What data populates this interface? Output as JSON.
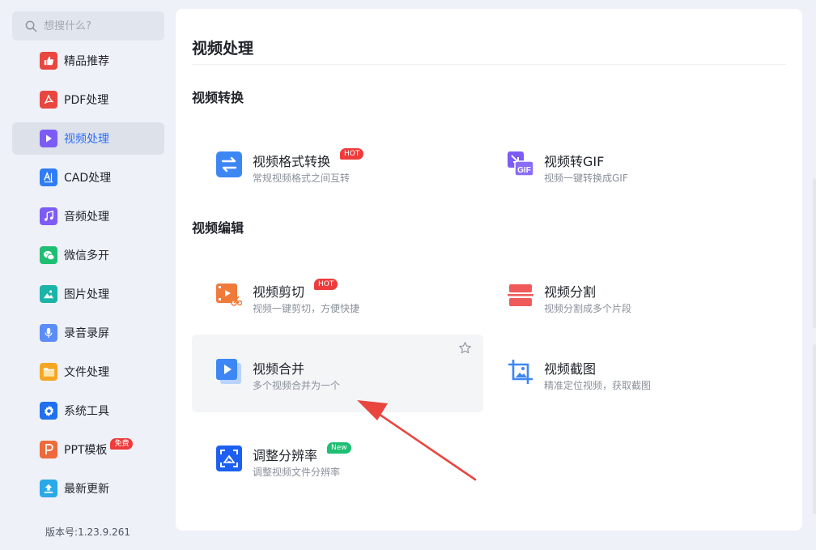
{
  "search": {
    "placeholder": "想搜什么?"
  },
  "sidebar": {
    "items": [
      {
        "label": "精品推荐",
        "icon": "thumbs-up-icon",
        "color": "#e8463f"
      },
      {
        "label": "PDF处理",
        "icon": "pdf-icon",
        "color": "#e8463f"
      },
      {
        "label": "视频处理",
        "icon": "play-icon",
        "color": "#7d5cf5"
      },
      {
        "label": "CAD处理",
        "icon": "cad-icon",
        "color": "#2f7cf6"
      },
      {
        "label": "音频处理",
        "icon": "music-note-icon",
        "color": "#7d5cf5"
      },
      {
        "label": "微信多开",
        "icon": "wechat-icon",
        "color": "#1fbf73"
      },
      {
        "label": "图片处理",
        "icon": "image-icon",
        "color": "#1bb4a8"
      },
      {
        "label": "录音录屏",
        "icon": "microphone-icon",
        "color": "#5b8cf7"
      },
      {
        "label": "文件处理",
        "icon": "folder-icon",
        "color": "#f5a623"
      },
      {
        "label": "系统工具",
        "icon": "gear-icon",
        "color": "#1f6ff0"
      },
      {
        "label": "PPT模板",
        "icon": "ppt-icon",
        "color": "#ee6a3b",
        "badge": "免费"
      },
      {
        "label": "最新更新",
        "icon": "upload-icon",
        "color": "#2aa9e8"
      }
    ],
    "version": "版本号:1.23.9.261"
  },
  "main": {
    "title": "视频处理",
    "sections": [
      {
        "title": "视频转换",
        "cards": [
          {
            "title": "视频格式转换",
            "desc": "常规视频格式之间互转",
            "tag": "HOT",
            "icon": "convert-arrows-icon"
          },
          {
            "title": "视频转GIF",
            "desc": "视频一键转换成GIF",
            "icon": "gif-icon"
          }
        ]
      },
      {
        "title": "视频编辑",
        "cards": [
          {
            "title": "视频剪切",
            "desc": "视频一键剪切，方便快捷",
            "tag": "HOT",
            "icon": "video-cut-icon"
          },
          {
            "title": "视频分割",
            "desc": "视频分割成多个片段",
            "icon": "split-icon"
          },
          {
            "title": "视频合并",
            "desc": "多个视频合并为一个",
            "icon": "merge-video-icon"
          },
          {
            "title": "视频截图",
            "desc": "精准定位视频，获取截图",
            "icon": "crop-image-icon"
          },
          {
            "title": "调整分辨率",
            "desc": "调整视频文件分辨率",
            "tag": "New",
            "icon": "resolution-icon"
          }
        ]
      }
    ]
  },
  "colors": {
    "accent": "#2f6cf6",
    "hot": "#ee3b3b",
    "new": "#1fbf73",
    "arrow": "#e8463f"
  }
}
